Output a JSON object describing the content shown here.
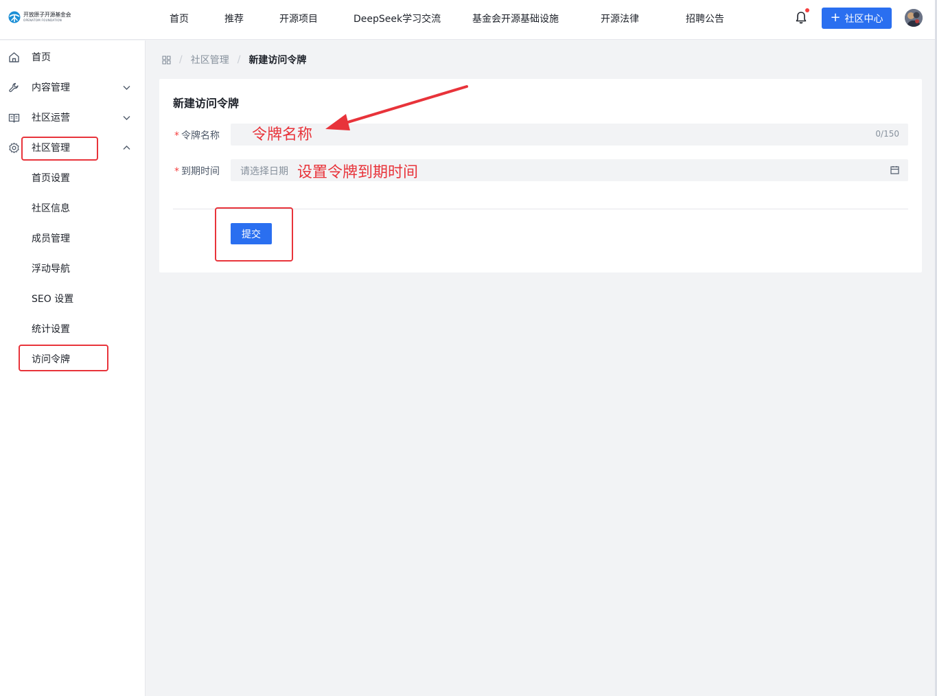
{
  "header": {
    "logo_cn": "开放原子开源基金会",
    "logo_en": "OPENATOM FOUNDATION",
    "nav": [
      {
        "label": "首页"
      },
      {
        "label": "推荐"
      },
      {
        "label": "开源项目"
      },
      {
        "label": "DeepSeek学习交流"
      },
      {
        "label": "基金会开源基础设施"
      },
      {
        "label": "开源法律"
      },
      {
        "label": "招聘公告"
      }
    ],
    "community_button": "社区中心",
    "community_button_icon": "plus-icon",
    "bell_icon": "bell-icon",
    "has_notification": true
  },
  "sidebar": {
    "items": [
      {
        "label": "首页",
        "icon": "home-icon"
      },
      {
        "label": "内容管理",
        "icon": "wrench-icon",
        "expanded": false
      },
      {
        "label": "社区运营",
        "icon": "book-icon",
        "expanded": false
      },
      {
        "label": "社区管理",
        "icon": "gear-icon",
        "expanded": true
      }
    ],
    "sub_items": [
      {
        "label": "首页设置"
      },
      {
        "label": "社区信息"
      },
      {
        "label": "成员管理"
      },
      {
        "label": "浮动导航"
      },
      {
        "label": "SEO 设置"
      },
      {
        "label": "统计设置"
      },
      {
        "label": "访问令牌"
      }
    ]
  },
  "breadcrumb": {
    "icon": "grid-icon",
    "items": [
      "社区管理",
      "新建访问令牌"
    ]
  },
  "form": {
    "title": "新建访问令牌",
    "name_label": "令牌名称",
    "name_value": "",
    "name_counter": "0/150",
    "date_label": "到期时间",
    "date_placeholder": "请选择日期",
    "date_icon": "calendar-icon",
    "submit_label": "提交"
  },
  "annotations": {
    "name_note": "令牌名称",
    "date_note": "设置令牌到期时间",
    "color": "#e8333a"
  },
  "colors": {
    "primary": "#2a6ff0",
    "danger": "#f53f3f",
    "annotation": "#e8333a"
  }
}
